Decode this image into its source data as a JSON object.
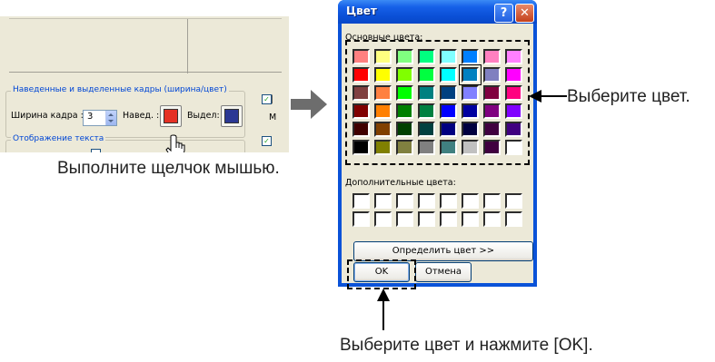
{
  "fragment": {
    "group1_title": "Наведенные и выделенные кадры (ширина/цвет)",
    "frame_width_label": "Ширина кадра :",
    "frame_width_value": "3",
    "hover_label": "Навед. :",
    "selected_label": "Выдел:",
    "right_clip_letter": "М",
    "group2_title": "Отображение текста",
    "hover_color": "#e53125",
    "selected_color": "#2b3894"
  },
  "captions": {
    "click_instruction": "Выполните щелчок мышью.",
    "select_color": "Выберите цвет.",
    "select_and_ok": "Выберите цвет и нажмите [OK]."
  },
  "dialog": {
    "title": "Цвет",
    "help_button": "?",
    "close_button": "✕",
    "basic_colors_label": "Основные цвета:",
    "custom_colors_label": "Дополнительные цвета:",
    "define_button": "Определить цвет >>",
    "ok_button": "OK",
    "cancel_button": "Отмена",
    "selected_swatch": "#0080c0",
    "basic_colors": [
      [
        "#ff8080",
        "#ffff80",
        "#80ff80",
        "#00ff80",
        "#80ffff",
        "#0080ff",
        "#ff80c0",
        "#ff80ff"
      ],
      [
        "#ff0000",
        "#ffff00",
        "#80ff00",
        "#00ff40",
        "#00ffff",
        "#0080c0",
        "#8080c0",
        "#ff00ff"
      ],
      [
        "#804040",
        "#ff8040",
        "#00ff00",
        "#008080",
        "#004080",
        "#8080ff",
        "#800040",
        "#ff0080"
      ],
      [
        "#800000",
        "#ff8000",
        "#008000",
        "#008040",
        "#0000ff",
        "#0000a0",
        "#800080",
        "#8000ff"
      ],
      [
        "#400000",
        "#804000",
        "#004000",
        "#004040",
        "#000080",
        "#000040",
        "#400040",
        "#400080"
      ],
      [
        "#000000",
        "#808000",
        "#808040",
        "#808080",
        "#408080",
        "#c0c0c0",
        "#400040",
        "#ffffff"
      ]
    ]
  }
}
